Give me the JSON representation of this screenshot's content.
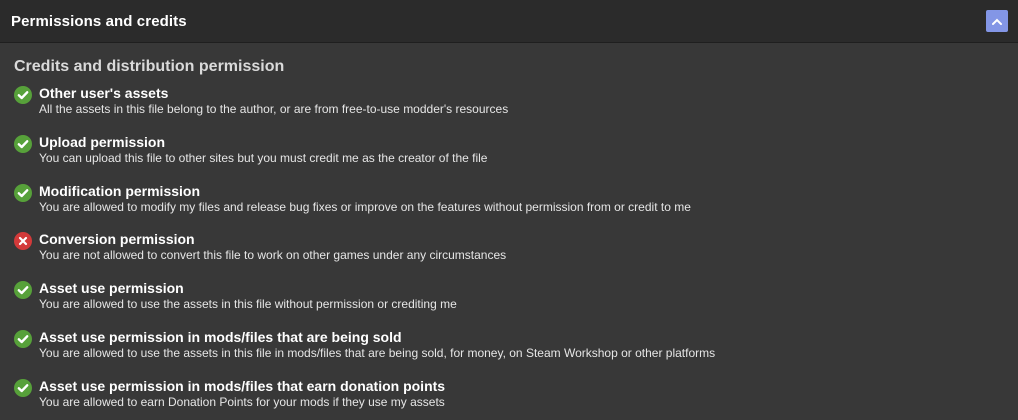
{
  "panel": {
    "title": "Permissions and credits",
    "collapse_icon": "chevron-up-icon",
    "accent_color": "#8396e6"
  },
  "section": {
    "title": "Credits and distribution permission"
  },
  "status_colors": {
    "allowed": "#57a13a",
    "denied": "#d33a3a"
  },
  "permissions": [
    {
      "status": "allowed",
      "icon": "check-circle-icon",
      "name": "Other user's assets",
      "description": "All the assets in this file belong to the author, or are from free-to-use modder's resources"
    },
    {
      "status": "allowed",
      "icon": "check-circle-icon",
      "name": "Upload permission",
      "description": "You can upload this file to other sites but you must credit me as the creator of the file"
    },
    {
      "status": "allowed",
      "icon": "check-circle-icon",
      "name": "Modification permission",
      "description": "You are allowed to modify my files and release bug fixes or improve on the features without permission from or credit to me"
    },
    {
      "status": "denied",
      "icon": "cross-circle-icon",
      "name": "Conversion permission",
      "description": "You are not allowed to convert this file to work on other games under any circumstances"
    },
    {
      "status": "allowed",
      "icon": "check-circle-icon",
      "name": "Asset use permission",
      "description": "You are allowed to use the assets in this file without permission or crediting me"
    },
    {
      "status": "allowed",
      "icon": "check-circle-icon",
      "name": "Asset use permission in mods/files that are being sold",
      "description": "You are allowed to use the assets in this file in mods/files that are being sold, for money, on Steam Workshop or other platforms"
    },
    {
      "status": "allowed",
      "icon": "check-circle-icon",
      "name": "Asset use permission in mods/files that earn donation points",
      "description": "You are allowed to earn Donation Points for your mods if they use my assets"
    }
  ]
}
